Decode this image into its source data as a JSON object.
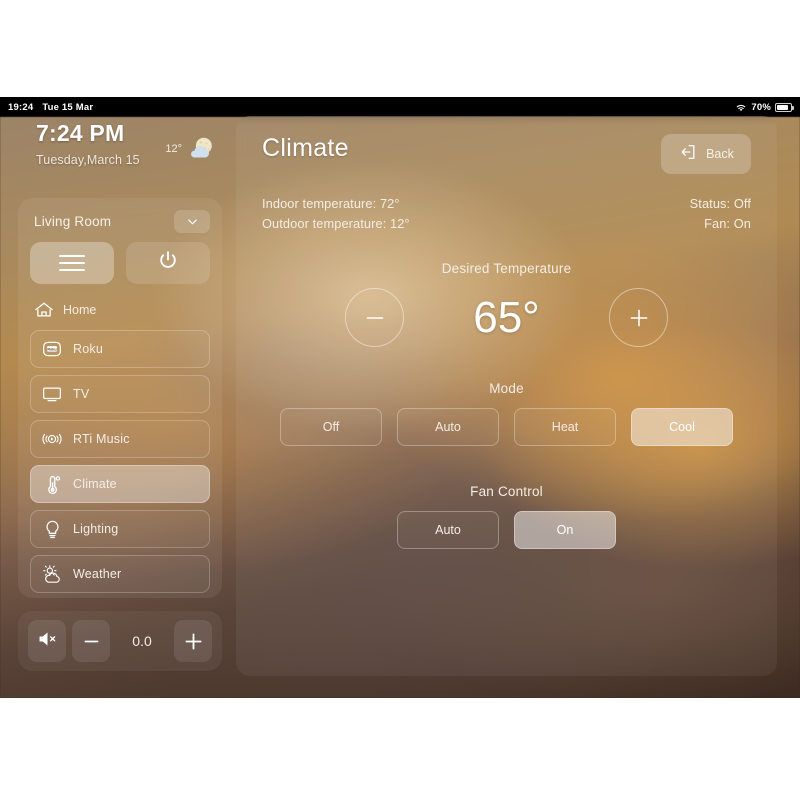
{
  "statusbar": {
    "time": "19:24",
    "date": "Tue 15 Mar",
    "battery_percent": "70%",
    "wifi_icon": "wifi-icon",
    "battery_icon": "battery-icon"
  },
  "sidebar": {
    "clock": {
      "time": "7:24 PM",
      "date": "Tuesday,March 15"
    },
    "weather": {
      "temperature": "12°",
      "icon": "moon-behind-cloud-icon"
    },
    "room": {
      "name": "Living Room",
      "chevron_icon": "chevron-down-icon"
    },
    "controls": {
      "menu_icon": "hamburger-menu-icon",
      "power_icon": "power-icon"
    },
    "home": {
      "label": "Home",
      "icon": "house-icon"
    },
    "items": [
      {
        "label": "Roku",
        "icon": "roku-icon",
        "active": false
      },
      {
        "label": "TV",
        "icon": "television-icon",
        "active": false
      },
      {
        "label": "RTi Music",
        "icon": "speaker-wave-icon",
        "active": false
      },
      {
        "label": "Climate",
        "icon": "thermometer-icon",
        "active": true
      },
      {
        "label": "Lighting",
        "icon": "lightbulb-icon",
        "active": false
      },
      {
        "label": "Weather",
        "icon": "sun-behind-cloud-icon",
        "active": false
      }
    ],
    "volume": {
      "mute_icon": "speaker-mute-icon",
      "minus_label": "−",
      "value": "0.0",
      "plus_label": "+"
    }
  },
  "main": {
    "title": "Climate",
    "back": {
      "label": "Back",
      "icon": "exit-arrow-icon"
    },
    "info": {
      "indoor": "Indoor temperature: 72°",
      "outdoor": "Outdoor temperature: 12°",
      "status": "Status: Off",
      "fan": "Fan: On"
    },
    "desired": {
      "label": "Desired Temperature",
      "value": "65°",
      "decrease_icon": "minus-icon",
      "increase_icon": "plus-icon"
    },
    "mode": {
      "label": "Mode",
      "options": [
        {
          "label": "Off",
          "active": false
        },
        {
          "label": "Auto",
          "active": false
        },
        {
          "label": "Heat",
          "active": false
        },
        {
          "label": "Cool",
          "active": true
        }
      ]
    },
    "fan_control": {
      "label": "Fan Control",
      "options": [
        {
          "label": "Auto",
          "active": false
        },
        {
          "label": "On",
          "active": true
        }
      ]
    }
  },
  "colors": {
    "accent_warm": "#b08a52",
    "panel_tint": "rgba(255,255,255,0.07)",
    "active_segment": "rgba(255,255,255,0.47)",
    "text_primary": "#ffffff"
  }
}
